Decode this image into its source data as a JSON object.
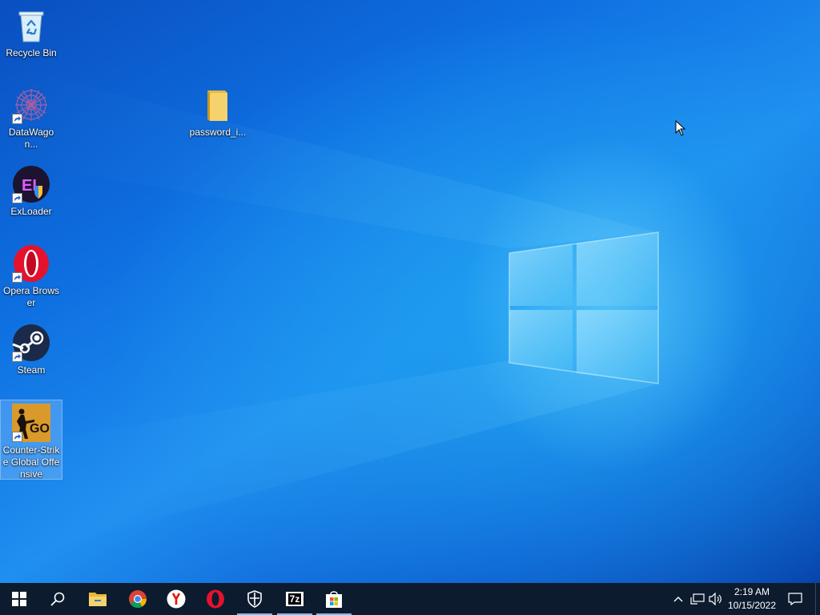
{
  "desktop": {
    "icons": [
      {
        "label": "Recycle Bin"
      },
      {
        "label": "DataWagon..."
      },
      {
        "label": "ExLoader"
      },
      {
        "label": "Opera Browser"
      },
      {
        "label": "Steam"
      },
      {
        "label": "Counter-Strike Global Offensive"
      },
      {
        "label": "password_i..."
      }
    ]
  },
  "taskbar": {
    "pinned": [
      {
        "icon": "start-icon"
      },
      {
        "icon": "search-icon"
      },
      {
        "icon": "file-explorer-icon"
      },
      {
        "icon": "chrome-icon"
      },
      {
        "icon": "yandex-browser-icon"
      },
      {
        "icon": "opera-icon"
      },
      {
        "icon": "security-shield-icon"
      },
      {
        "icon": "7zip-icon"
      },
      {
        "icon": "microsoft-store-icon"
      }
    ],
    "seven_zip_text": "7z",
    "clock": {
      "time": "2:19 AM",
      "date": "10/15/2022"
    }
  },
  "colors": {
    "taskbar_bg": "#0d1b2e",
    "active_indicator": "#7fb7ee",
    "wallpaper_accent": "#1e9ff0"
  }
}
